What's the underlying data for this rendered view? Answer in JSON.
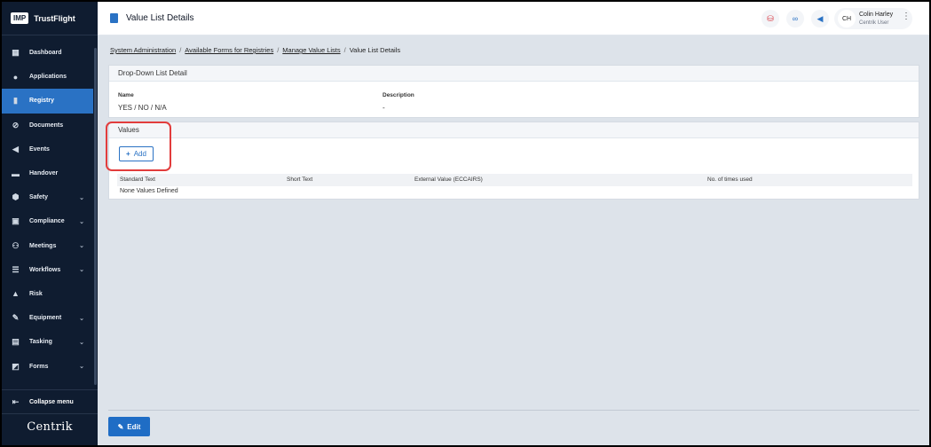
{
  "brand": {
    "logo": "IMP",
    "name": "TrustFlight"
  },
  "sidebar": {
    "items": [
      {
        "label": "Dashboard",
        "icon": "dashboard-icon",
        "chevron": false
      },
      {
        "label": "Applications",
        "icon": "user-icon",
        "chevron": false
      },
      {
        "label": "Registry",
        "icon": "book-icon",
        "chevron": false,
        "active": true
      },
      {
        "label": "Documents",
        "icon": "paperclip-icon",
        "chevron": false
      },
      {
        "label": "Events",
        "icon": "megaphone-icon",
        "chevron": false
      },
      {
        "label": "Handover",
        "icon": "handover-icon",
        "chevron": false
      },
      {
        "label": "Safety",
        "icon": "shield-icon",
        "chevron": true
      },
      {
        "label": "Compliance",
        "icon": "compliance-icon",
        "chevron": true
      },
      {
        "label": "Meetings",
        "icon": "meetings-icon",
        "chevron": true
      },
      {
        "label": "Workflows",
        "icon": "workflow-icon",
        "chevron": true
      },
      {
        "label": "Risk",
        "icon": "risk-icon",
        "chevron": false
      },
      {
        "label": "Equipment",
        "icon": "wrench-icon",
        "chevron": true
      },
      {
        "label": "Tasking",
        "icon": "task-icon",
        "chevron": true
      },
      {
        "label": "Forms",
        "icon": "forms-icon",
        "chevron": true
      }
    ],
    "collapse_label": "Collapse menu",
    "footer_logo": "Centrik"
  },
  "header": {
    "title": "Value List Details",
    "user_initials": "CH",
    "user_name": "Colin Harley",
    "user_role": "Centrik User"
  },
  "breadcrumb": {
    "items": [
      "System Administration",
      "Available Forms for Registries",
      "Manage Value Lists"
    ],
    "current": "Value List Details",
    "separator": "/"
  },
  "detail_card": {
    "title": "Drop-Down List Detail",
    "name_label": "Name",
    "name_value": "YES / NO / N/A",
    "description_label": "Description",
    "description_value": "-"
  },
  "values_card": {
    "title": "Values",
    "add_label": "Add",
    "columns": [
      "Standard Text",
      "Short Text",
      "External Value (ECCAIRS)",
      "No. of times used"
    ],
    "empty_text": "None Values Defined"
  },
  "footer": {
    "edit_label": "Edit"
  },
  "colors": {
    "sidebar_bg": "#0f1c30",
    "accent": "#2a72c4",
    "highlight": "#e23c3c"
  }
}
